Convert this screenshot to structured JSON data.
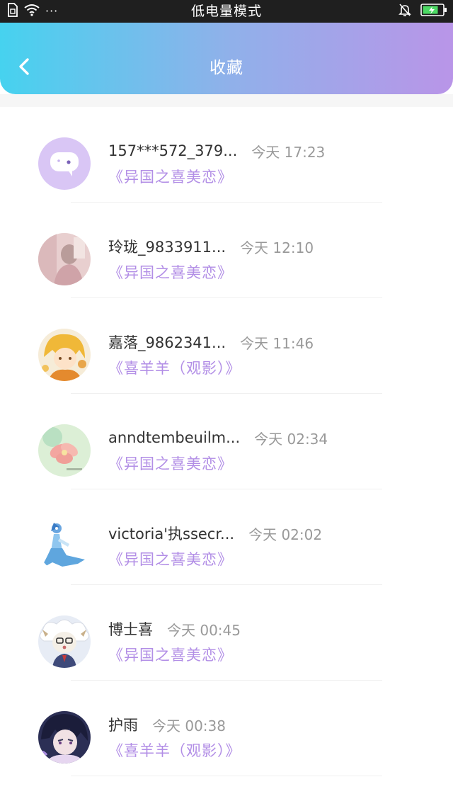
{
  "status_bar": {
    "title": "低电量模式",
    "dots": "···"
  },
  "header": {
    "title": "收藏"
  },
  "colors": {
    "header_gradient": [
      "#46d2ef",
      "#8fb1ea",
      "#b995e8"
    ],
    "link": "#b28ee6",
    "timestamp": "#999999",
    "username": "#333333"
  },
  "items": [
    {
      "username": "157***572_379...",
      "time": "今天 17:23",
      "title": "《异国之喜美恋》",
      "avatar": "chat-bubble-avatar"
    },
    {
      "username": "玲珑_9833911...",
      "time": "今天 12:10",
      "title": "《异国之喜美恋》",
      "avatar": "photo-avatar"
    },
    {
      "username": "嘉落_9862341...",
      "time": "今天 11:46",
      "title": "《喜羊羊（观影）》",
      "avatar": "anime-avatar"
    },
    {
      "username": "anndtembeuilm...",
      "time": "今天 02:34",
      "title": "《异国之喜美恋》",
      "avatar": "flower-avatar"
    },
    {
      "username": "victoria'执ssecr...",
      "time": "今天 02:02",
      "title": "《异国之喜美恋》",
      "avatar": "character-avatar"
    },
    {
      "username": "博士喜",
      "time": "今天 00:45",
      "title": "《异国之喜美恋》",
      "avatar": "sheep-avatar"
    },
    {
      "username": "护雨",
      "time": "今天 00:38",
      "title": "《喜羊羊（观影）》",
      "avatar": "anime-boy-avatar"
    }
  ]
}
